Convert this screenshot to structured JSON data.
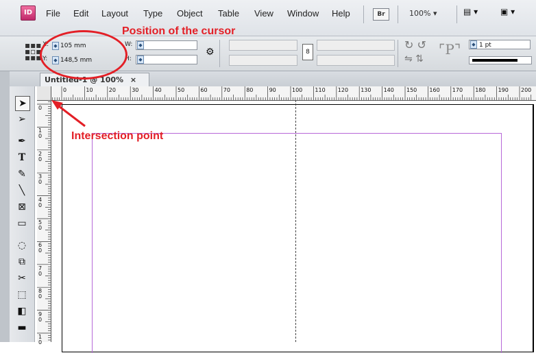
{
  "app": {
    "logo": "ID"
  },
  "menu": [
    "File",
    "Edit",
    "Layout",
    "Type",
    "Object",
    "Table",
    "View",
    "Window",
    "Help"
  ],
  "bridge_badge": "Br",
  "zoom": "100% ▾",
  "control": {
    "x_label": "X:",
    "x_value": "105 mm",
    "y_label": "Y:",
    "y_value": "148,5 mm",
    "w_label": "W:",
    "w_value": "",
    "h_label": "H:",
    "h_value": "",
    "stroke_weight": "1 pt"
  },
  "tab": {
    "title": "Untitled-1 @ 100%",
    "close": "×"
  },
  "ruler": {
    "h_ticks": [
      "0",
      "10",
      "20",
      "30",
      "40",
      "50",
      "60",
      "70",
      "80",
      "90",
      "100",
      "110",
      "120",
      "130",
      "140",
      "150",
      "160",
      "170",
      "180",
      "190",
      "200"
    ],
    "v_ticks": [
      "0",
      "1\n0",
      "2\n0",
      "3\n0",
      "4\n0",
      "5\n0",
      "6\n0",
      "7\n0",
      "8\n0",
      "9\n0",
      "1\n0"
    ]
  },
  "annotations": {
    "cursor": "Position of the cursor",
    "intersection": "Intersection point"
  },
  "colors": {
    "annotation": "#e31f26",
    "margin_guide": "#b667d8"
  }
}
